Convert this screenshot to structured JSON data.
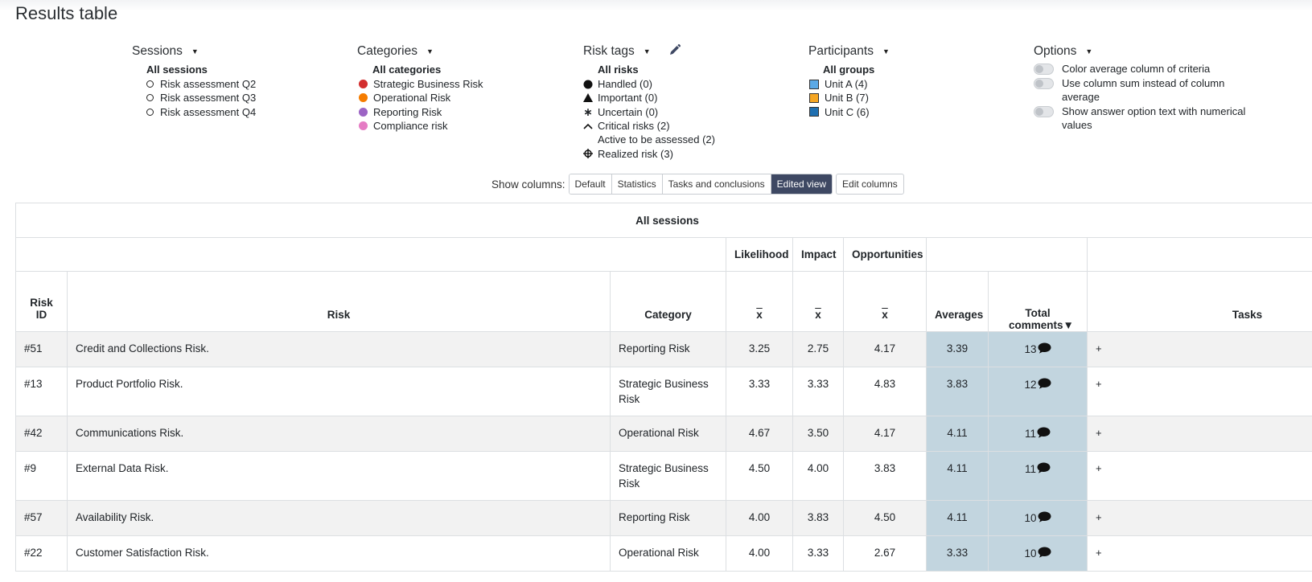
{
  "page_title": "Results table",
  "filters": {
    "sessions": {
      "label": "Sessions",
      "all_label": "All sessions",
      "items": [
        "Risk assessment Q2",
        "Risk assessment Q3",
        "Risk assessment Q4"
      ]
    },
    "categories": {
      "label": "Categories",
      "all_label": "All categories",
      "items": [
        {
          "label": "Strategic Business Risk",
          "color": "#d32f2f"
        },
        {
          "label": "Operational Risk",
          "color": "#f57c00"
        },
        {
          "label": "Reporting Risk",
          "color": "#9c64c4"
        },
        {
          "label": "Compliance risk",
          "color": "#e57cc4"
        }
      ]
    },
    "risk_tags": {
      "label": "Risk tags",
      "all_label": "All risks",
      "items": [
        {
          "label": "Handled (0)",
          "icon": "filled-circle-icon"
        },
        {
          "label": "Important (0)",
          "icon": "triangle-icon"
        },
        {
          "label": "Uncertain (0)",
          "icon": "asterisk-icon"
        },
        {
          "label": "Critical risks (2)",
          "icon": "caret-up-icon"
        },
        {
          "label": "Active to be assessed (2)",
          "icon": ""
        },
        {
          "label": "Realized risk (3)",
          "icon": "crosshair-icon"
        }
      ]
    },
    "participants": {
      "label": "Participants",
      "all_label": "All groups",
      "items": [
        {
          "label": "Unit A (4)",
          "color": "#5aa9e6"
        },
        {
          "label": "Unit B (7)",
          "color": "#f5a623"
        },
        {
          "label": "Unit C (6)",
          "color": "#1f6fb0"
        }
      ]
    },
    "options": {
      "label": "Options",
      "items": [
        "Color average column of criteria",
        "Use column sum instead of column average",
        "Show answer option text with numerical values"
      ]
    }
  },
  "show_columns": {
    "label": "Show columns:",
    "buttons": [
      "Default",
      "Statistics",
      "Tasks and conclusions",
      "Edited view"
    ],
    "active": "Edited view",
    "edit_label": "Edit columns"
  },
  "table": {
    "session_header": "All sessions",
    "criteria": [
      "Likelihood",
      "Impact",
      "Opportunities"
    ],
    "mean_symbol": "x",
    "headers": {
      "risk_id": "Risk ID",
      "risk": "Risk",
      "category": "Category",
      "averages": "Averages",
      "total_comments": "Total comments▼",
      "tasks": "Tasks"
    },
    "rows": [
      {
        "id": "#51",
        "risk": "Credit and Collections Risk.",
        "category": "Reporting Risk",
        "likelihood": "3.25",
        "impact": "2.75",
        "opportunities": "4.17",
        "average": "3.39",
        "comments": "13",
        "task": "+"
      },
      {
        "id": "#13",
        "risk": "Product Portfolio Risk.",
        "category": "Strategic Business Risk",
        "likelihood": "3.33",
        "impact": "3.33",
        "opportunities": "4.83",
        "average": "3.83",
        "comments": "12",
        "task": "+"
      },
      {
        "id": "#42",
        "risk": "Communications Risk.",
        "category": "Operational Risk",
        "likelihood": "4.67",
        "impact": "3.50",
        "opportunities": "4.17",
        "average": "4.11",
        "comments": "11",
        "task": "+"
      },
      {
        "id": "#9",
        "risk": "External Data Risk.",
        "category": "Strategic Business Risk",
        "likelihood": "4.50",
        "impact": "4.00",
        "opportunities": "3.83",
        "average": "4.11",
        "comments": "11",
        "task": "+"
      },
      {
        "id": "#57",
        "risk": "Availability Risk.",
        "category": "Reporting Risk",
        "likelihood": "4.00",
        "impact": "3.83",
        "opportunities": "4.50",
        "average": "4.11",
        "comments": "10",
        "task": "+"
      },
      {
        "id": "#22",
        "risk": "Customer Satisfaction Risk.",
        "category": "Operational Risk",
        "likelihood": "4.00",
        "impact": "3.33",
        "opportunities": "2.67",
        "average": "3.33",
        "comments": "10",
        "task": "+"
      }
    ]
  }
}
